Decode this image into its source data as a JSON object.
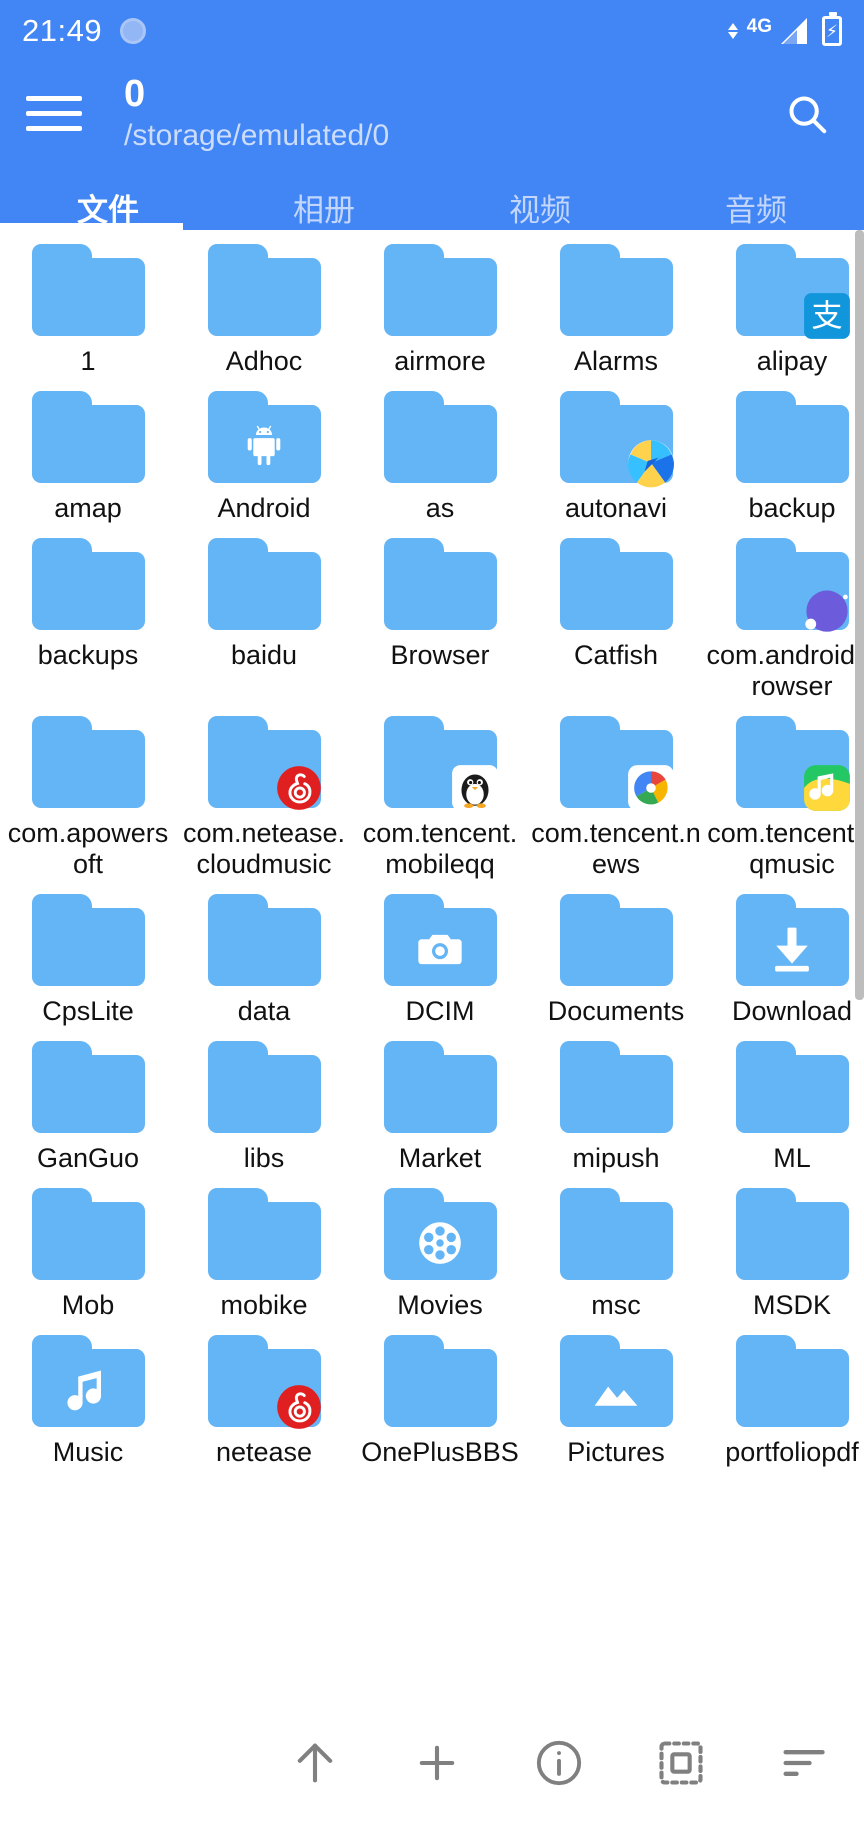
{
  "status_bar": {
    "time": "21:49",
    "sync_icon": "sync-circle-icon",
    "network_type": "4G",
    "signal_icon": "signal-bars-icon",
    "battery_icon": "battery-charging-icon",
    "data_arrows_icon": "data-transfer-arrows-icon"
  },
  "app_bar": {
    "menu_icon": "hamburger-menu-icon",
    "title": "0",
    "path": "/storage/emulated/0",
    "search_icon": "search-icon"
  },
  "tabs": [
    {
      "label": "文件",
      "active": true
    },
    {
      "label": "相册",
      "active": false
    },
    {
      "label": "视频",
      "active": false
    },
    {
      "label": "音频",
      "active": false
    }
  ],
  "colors": {
    "header_blue": "#4285f4",
    "folder_blue": "#64b5f6",
    "tab_inactive": "#c3d6fb",
    "label_text": "#111111",
    "toolbar_icon": "#808080"
  },
  "files": [
    {
      "name": "1",
      "badge": "none"
    },
    {
      "name": "Adhoc",
      "badge": "none"
    },
    {
      "name": "airmore",
      "badge": "none"
    },
    {
      "name": "Alarms",
      "badge": "none"
    },
    {
      "name": "alipay",
      "badge": "alipay-icon"
    },
    {
      "name": "amap",
      "badge": "none"
    },
    {
      "name": "Android",
      "badge": "android-robot-icon"
    },
    {
      "name": "as",
      "badge": "none"
    },
    {
      "name": "autonavi",
      "badge": "amap-compass-icon"
    },
    {
      "name": "backup",
      "badge": "none"
    },
    {
      "name": "backups",
      "badge": "none"
    },
    {
      "name": "baidu",
      "badge": "none"
    },
    {
      "name": "Browser",
      "badge": "none"
    },
    {
      "name": "Catfish",
      "badge": "none"
    },
    {
      "name": "com.android.browser",
      "badge": "browser-purple-icon"
    },
    {
      "name": "com.apowersoft",
      "badge": "none"
    },
    {
      "name": "com.netease.cloudmusic",
      "badge": "netease-music-icon"
    },
    {
      "name": "com.tencent.mobileqq",
      "badge": "qq-penguin-icon"
    },
    {
      "name": "com.tencent.news",
      "badge": "tencent-news-icon"
    },
    {
      "name": "com.tencent.qqmusic",
      "badge": "qq-music-icon"
    },
    {
      "name": "CpsLite",
      "badge": "none"
    },
    {
      "name": "data",
      "badge": "none"
    },
    {
      "name": "DCIM",
      "badge": "camera-icon"
    },
    {
      "name": "Documents",
      "badge": "none"
    },
    {
      "name": "Download",
      "badge": "download-arrow-icon"
    },
    {
      "name": "GanGuo",
      "badge": "none"
    },
    {
      "name": "libs",
      "badge": "none"
    },
    {
      "name": "Market",
      "badge": "none"
    },
    {
      "name": "mipush",
      "badge": "none"
    },
    {
      "name": "ML",
      "badge": "none"
    },
    {
      "name": "Mob",
      "badge": "none"
    },
    {
      "name": "mobike",
      "badge": "none"
    },
    {
      "name": "Movies",
      "badge": "film-reel-icon"
    },
    {
      "name": "msc",
      "badge": "none"
    },
    {
      "name": "MSDK",
      "badge": "none"
    },
    {
      "name": "Music",
      "badge": "music-note-icon"
    },
    {
      "name": "netease",
      "badge": "netease-music-icon"
    },
    {
      "name": "OnePlusBBS",
      "badge": "none"
    },
    {
      "name": "Pictures",
      "badge": "mountain-picture-icon"
    },
    {
      "name": "portfoliopdf",
      "badge": "none"
    }
  ],
  "bottom_toolbar": [
    {
      "name": "up-arrow-icon",
      "label": "Up"
    },
    {
      "name": "plus-icon",
      "label": "New"
    },
    {
      "name": "info-icon",
      "label": "Info"
    },
    {
      "name": "select-all-icon",
      "label": "Select"
    },
    {
      "name": "sort-icon",
      "label": "Sort"
    }
  ]
}
